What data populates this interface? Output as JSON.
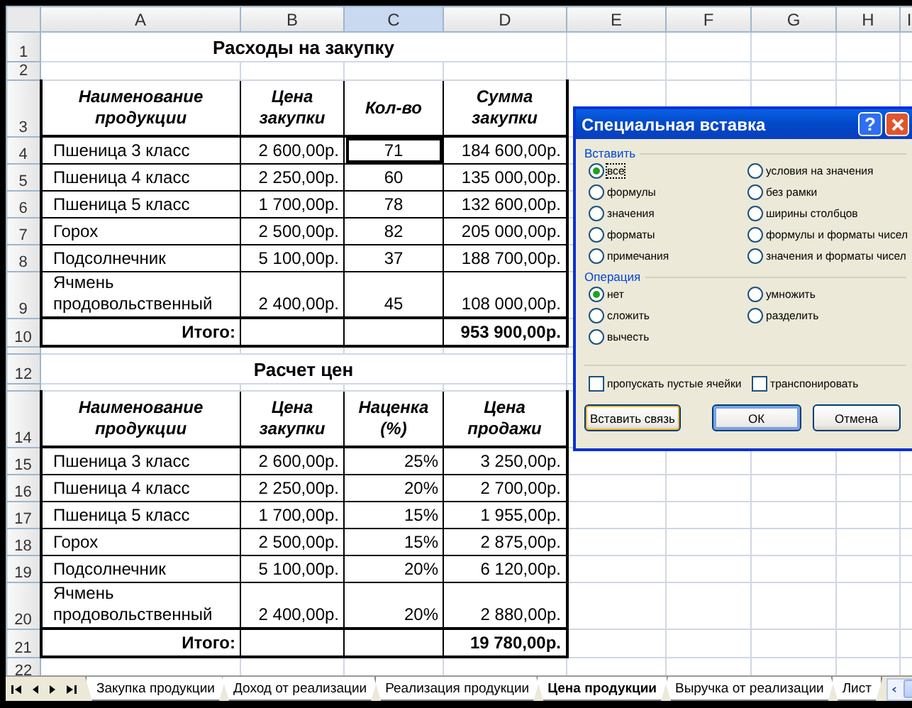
{
  "sheet": {
    "columns": [
      {
        "label": "A",
        "selected": false
      },
      {
        "label": "B",
        "selected": false
      },
      {
        "label": "C",
        "selected": true
      },
      {
        "label": "D",
        "selected": false
      },
      {
        "label": "E",
        "selected": false
      },
      {
        "label": "F",
        "selected": false
      },
      {
        "label": "G",
        "selected": false
      },
      {
        "label": "H",
        "selected": false
      },
      {
        "label": "I",
        "selected": false
      }
    ],
    "rows": [
      {
        "number": "1",
        "kind": "title",
        "text": "Расходы на закупку"
      },
      {
        "number": "2",
        "kind": "spacer"
      },
      {
        "number": "3",
        "kind": "header",
        "cells": [
          "Наименование продукции",
          "Цена закупки",
          "Кол-во",
          "Сумма закупки"
        ]
      },
      {
        "number": "4",
        "kind": "data",
        "active": true,
        "centered_third": true,
        "cells": [
          "Пшеница 3 класс",
          "2 600,00р.",
          "71",
          "184 600,00р."
        ]
      },
      {
        "number": "5",
        "kind": "data",
        "centered_third": true,
        "cells": [
          "Пшеница 4 класс",
          "2 250,00р.",
          "60",
          "135 000,00р."
        ]
      },
      {
        "number": "6",
        "kind": "data",
        "centered_third": true,
        "cells": [
          "Пшеница 5 класс",
          "1 700,00р.",
          "78",
          "132 600,00р."
        ]
      },
      {
        "number": "7",
        "kind": "data",
        "centered_third": true,
        "cells": [
          "Горох",
          "2 500,00р.",
          "82",
          "205 000,00р."
        ]
      },
      {
        "number": "8",
        "kind": "data",
        "centered_third": true,
        "cells": [
          "Подсолнечник",
          "5 100,00р.",
          "37",
          "188 700,00р."
        ]
      },
      {
        "number": "9",
        "kind": "data",
        "centered_third": true,
        "cells": [
          "Ячмень продовольственный",
          "2 400,00р.",
          "45",
          "108 000,00р."
        ]
      },
      {
        "number": "10",
        "kind": "total",
        "label": "Итого:",
        "value": "953 900,00р."
      },
      {
        "kind": "spacer"
      },
      {
        "number": "12",
        "kind": "title",
        "text": "Расчет цен"
      },
      {
        "kind": "spacer"
      },
      {
        "number": "14",
        "kind": "header",
        "cells": [
          "Наименование продукции",
          "Цена закупки",
          "Наценка (%)",
          "Цена продажи"
        ]
      },
      {
        "number": "15",
        "kind": "data",
        "centered_third": false,
        "cells": [
          "Пшеница 3 класс",
          "2 600,00р.",
          "25%",
          "3 250,00р."
        ]
      },
      {
        "number": "16",
        "kind": "data",
        "centered_third": false,
        "cells": [
          "Пшеница 4 класс",
          "2 250,00р.",
          "20%",
          "2 700,00р."
        ]
      },
      {
        "number": "17",
        "kind": "data",
        "centered_third": false,
        "cells": [
          "Пшеница 5 класс",
          "1 700,00р.",
          "15%",
          "1 955,00р."
        ]
      },
      {
        "number": "18",
        "kind": "data",
        "centered_third": false,
        "cells": [
          "Горох",
          "2 500,00р.",
          "15%",
          "2 875,00р."
        ]
      },
      {
        "number": "19",
        "kind": "data",
        "centered_third": false,
        "cells": [
          "Подсолнечник",
          "5 100,00р.",
          "20%",
          "6 120,00р."
        ]
      },
      {
        "number": "20",
        "kind": "data",
        "centered_third": false,
        "cells": [
          "Ячмень продовольственный",
          "2 400,00р.",
          "20%",
          "2 880,00р."
        ]
      },
      {
        "number": "21",
        "kind": "total",
        "label": "Итого:",
        "value": "19 780,00р."
      },
      {
        "number": "22",
        "kind": "spacer"
      }
    ]
  },
  "sheet_tabs": [
    {
      "label": "Закупка продукции",
      "selected": false
    },
    {
      "label": "Доход от реализации",
      "selected": false
    },
    {
      "label": "Реализация продукции",
      "selected": false
    },
    {
      "label": "Цена продукции",
      "selected": true
    },
    {
      "label": "Выручка от реализации",
      "selected": false
    },
    {
      "label": "Лист",
      "selected": false
    }
  ],
  "dialog": {
    "title": "Специальная вставка",
    "help": "?",
    "groups": [
      {
        "title": "Вставить",
        "options": [
          {
            "label": "все",
            "selected": true
          },
          {
            "label": "формулы",
            "selected": false
          },
          {
            "label": "значения",
            "selected": false
          },
          {
            "label": "форматы",
            "selected": false
          },
          {
            "label": "примечания",
            "selected": false
          },
          {
            "label": "условия на значения",
            "selected": false
          },
          {
            "label": "без рамки",
            "selected": false
          },
          {
            "label": "ширины столбцов",
            "selected": false
          },
          {
            "label": "формулы и форматы чисел",
            "selected": false
          },
          {
            "label": "значения и форматы чисел",
            "selected": false
          }
        ]
      },
      {
        "title": "Операция",
        "options": [
          {
            "label": "нет",
            "selected": true
          },
          {
            "label": "сложить",
            "selected": false
          },
          {
            "label": "вычесть",
            "selected": false
          },
          {
            "label": "умножить",
            "selected": false
          },
          {
            "label": "разделить",
            "selected": false
          }
        ]
      }
    ],
    "checkboxes": [
      {
        "label": "пропускать пустые ячейки",
        "checked": false
      },
      {
        "label": "транспонировать",
        "checked": false
      }
    ],
    "buttons": [
      {
        "label": "Вставить связь",
        "kind": "secondary"
      },
      {
        "label": "ОК",
        "kind": "default"
      },
      {
        "label": "Отмена",
        "kind": "normal"
      }
    ]
  }
}
